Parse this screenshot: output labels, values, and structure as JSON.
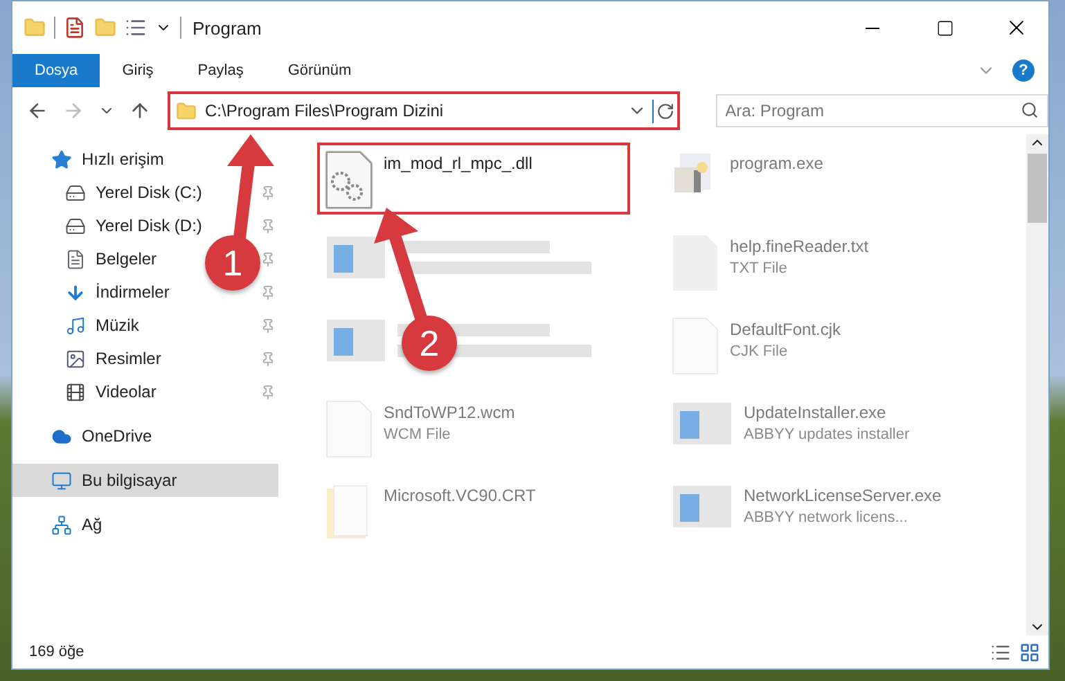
{
  "window": {
    "title": "Program",
    "help_button": "?"
  },
  "ribbon_tabs": [
    {
      "label": "Dosya",
      "selected": true
    },
    {
      "label": "Giriş",
      "selected": false
    },
    {
      "label": "Paylaş",
      "selected": false
    },
    {
      "label": "Görünüm",
      "selected": false
    }
  ],
  "address": {
    "path": "C:\\Program Files\\Program Dizini",
    "highlighted": true
  },
  "search": {
    "placeholder": "Ara: Program"
  },
  "sidebar": {
    "items": [
      {
        "label": "Hızlı erişim",
        "kind": "star",
        "selected": false,
        "children": [
          {
            "label": "Yerel Disk (C:)",
            "kind": "disk",
            "pinned": true,
            "selected": false
          },
          {
            "label": "Yerel Disk (D:)",
            "kind": "disk",
            "pinned": true,
            "selected": false
          },
          {
            "label": "Belgeler",
            "kind": "docs",
            "pinned": true,
            "selected": false
          },
          {
            "label": "İndirmeler",
            "kind": "download",
            "pinned": true,
            "selected": false
          },
          {
            "label": "Müzik",
            "kind": "music",
            "pinned": true,
            "selected": false
          },
          {
            "label": "Resimler",
            "kind": "pictures",
            "pinned": true,
            "selected": false
          },
          {
            "label": "Videolar",
            "kind": "videos",
            "pinned": true,
            "selected": false
          }
        ]
      },
      {
        "label": "OneDrive",
        "kind": "cloud",
        "selected": false
      },
      {
        "label": "Bu bilgisayar",
        "kind": "computer",
        "selected": true
      },
      {
        "label": "Ağ",
        "kind": "network",
        "selected": false
      }
    ]
  },
  "files": [
    {
      "name": "im_mod_rl_mpc_.dll",
      "kind": "dll",
      "faded": false,
      "highlighted": true
    },
    {
      "name": "program.exe",
      "kind": "program",
      "faded": true,
      "highlighted": false
    },
    {
      "kind": "app",
      "faded": true,
      "highlighted": false
    },
    {
      "name": "help.fineReader.txt",
      "type": "TXT File",
      "kind": "grey-doc",
      "faded": true,
      "highlighted": false
    },
    {
      "kind": "app",
      "faded": true,
      "highlighted": false
    },
    {
      "name": "DefaultFont.cjk",
      "type": "CJK File",
      "kind": "doc",
      "faded": true,
      "highlighted": false
    },
    {
      "name": "SndToWP12.wcm",
      "type": "WCM File",
      "kind": "doc",
      "faded": true,
      "highlighted": false
    },
    {
      "name": "UpdateInstaller.exe",
      "type": "ABBYY updates installer",
      "kind": "app",
      "faded": true,
      "highlighted": false
    },
    {
      "name": "Microsoft.VC90.CRT",
      "kind": "folder",
      "faded": true,
      "highlighted": false
    },
    {
      "name": "NetworkLicenseServer.exe",
      "type": "ABBYY network licens...",
      "kind": "app",
      "faded": true,
      "highlighted": false
    }
  ],
  "annotations": [
    {
      "label": "1"
    },
    {
      "label": "2"
    }
  ],
  "status_bar": {
    "count": "169 öğe"
  }
}
